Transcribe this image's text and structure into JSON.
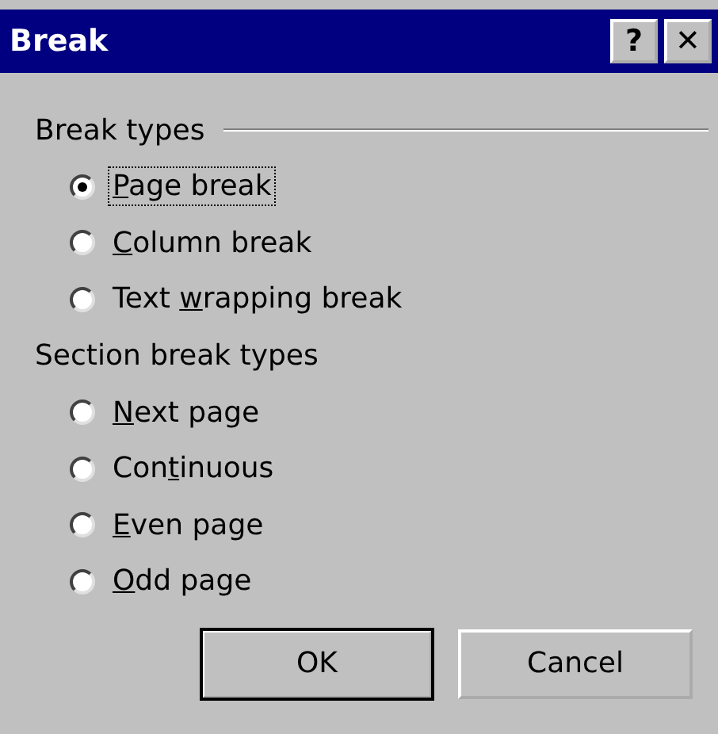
{
  "window": {
    "title": "Break",
    "help_button": "?",
    "close_button": "✕"
  },
  "groups": [
    {
      "heading": "Break types",
      "options": [
        {
          "key": "P",
          "after": "age break",
          "selected": true,
          "focused": true
        },
        {
          "key": "C",
          "after": "olumn break",
          "selected": false,
          "focused": false
        },
        {
          "before": "Text ",
          "key": "w",
          "after": "rapping break",
          "selected": false,
          "focused": false
        }
      ]
    },
    {
      "heading": "Section break types",
      "options": [
        {
          "key": "N",
          "after": "ext page",
          "selected": false,
          "focused": false
        },
        {
          "before": "Con",
          "key": "t",
          "after": "inuous",
          "selected": false,
          "focused": false
        },
        {
          "key": "E",
          "after": "ven page",
          "selected": false,
          "focused": false
        },
        {
          "key": "O",
          "after": "dd page",
          "selected": false,
          "focused": false
        }
      ]
    }
  ],
  "buttons": [
    {
      "label": "OK",
      "default": true
    },
    {
      "label": "Cancel",
      "default": false
    }
  ]
}
